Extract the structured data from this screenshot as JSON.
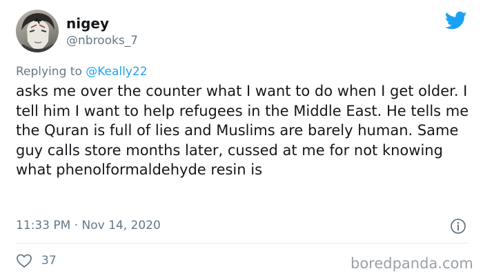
{
  "tweet": {
    "author": {
      "display_name": "nigey",
      "handle": "@nbrooks_7"
    },
    "reply": {
      "prefix": "Replying to ",
      "mention": "@Keally22"
    },
    "text": "asks me over the counter what I want to do when I get older. I tell him I want to help refugees in the Middle East. He tells me the Quran is full of lies and Muslims are barely human. Same guy calls store months later, cussed at me for not knowing what phenolformaldehyde resin is",
    "timestamp": "11:33 PM · Nov 14, 2020",
    "likes": "37"
  },
  "watermark": "boredpanda.com",
  "icons": {
    "brand": "twitter-bird-icon",
    "info": "info-icon",
    "like": "heart-icon"
  },
  "colors": {
    "brand_blue": "#1da1f2",
    "secondary_text": "#657786",
    "primary_text": "#14171a"
  }
}
